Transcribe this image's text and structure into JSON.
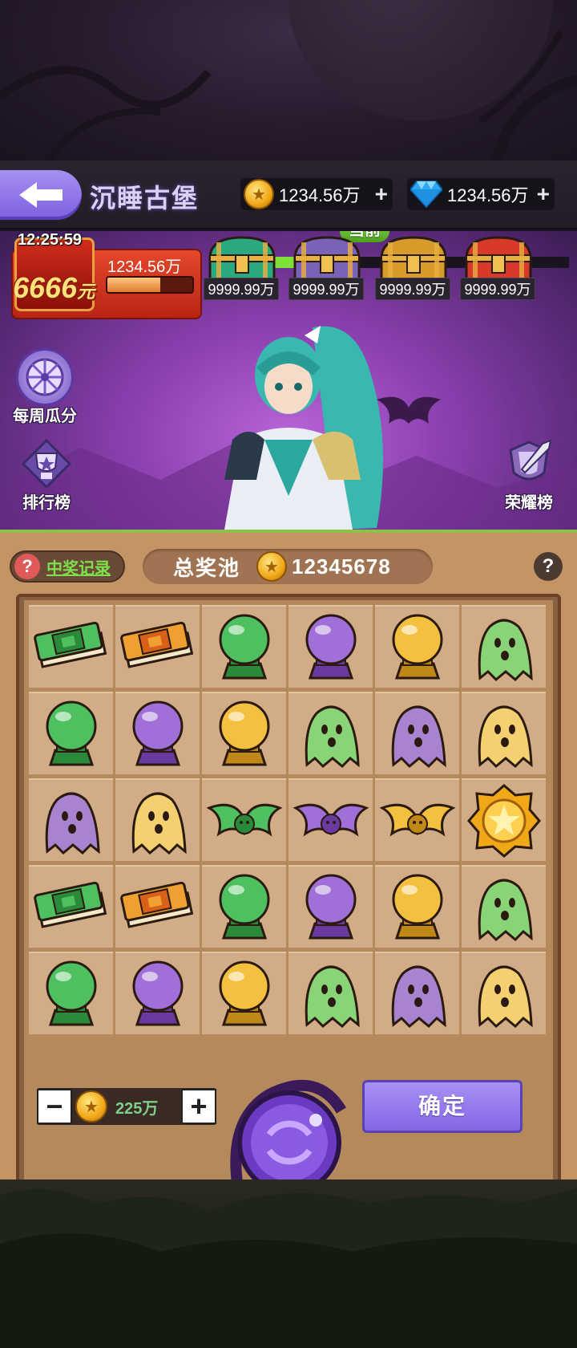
{
  "header": {
    "title": "沉睡古堡",
    "gold": "1234.56万",
    "gem": "1234.56万",
    "plus": "+"
  },
  "red_pack": {
    "timer": "12:25:59",
    "amount": "6666",
    "unit": "元",
    "value": "1234.56万",
    "progress": 0.62
  },
  "chests": {
    "current_label": "当前",
    "items": [
      {
        "label": "9999.99万",
        "color": "#2aa880"
      },
      {
        "label": "9999.99万",
        "color": "#7a62b8"
      },
      {
        "label": "9999.99万",
        "color": "#d89a28"
      },
      {
        "label": "9999.99万",
        "color": "#d83a2a"
      }
    ]
  },
  "side": {
    "weekly": "每周瓜分",
    "ranking": "排行榜",
    "honor": "荣耀榜"
  },
  "board": {
    "records": "中奖记录",
    "pool_label": "总奖池",
    "pool_value": "12345678",
    "help": "?",
    "grid": [
      [
        "green-book",
        "orange-book",
        "green-orb",
        "purple-orb",
        "gold-orb",
        "green-ghost"
      ],
      [
        "green-orb",
        "purple-orb",
        "gold-orb",
        "green-ghost",
        "purple-ghost",
        "gold-ghost"
      ],
      [
        "purple-ghost",
        "gold-ghost",
        "green-bat",
        "purple-bat",
        "gold-bat",
        "gold-medal"
      ],
      [
        "green-book",
        "orange-book",
        "green-orb",
        "purple-orb",
        "gold-orb",
        "green-ghost"
      ],
      [
        "green-orb",
        "purple-orb",
        "gold-orb",
        "green-ghost",
        "purple-ghost",
        "gold-ghost"
      ]
    ]
  },
  "controls": {
    "minus": "−",
    "plus": "+",
    "bet": "225万",
    "confirm": "确定"
  },
  "colors": {
    "accent_purple": "#8466e6",
    "green": "#7ee04a",
    "gold": "#f0a818"
  }
}
